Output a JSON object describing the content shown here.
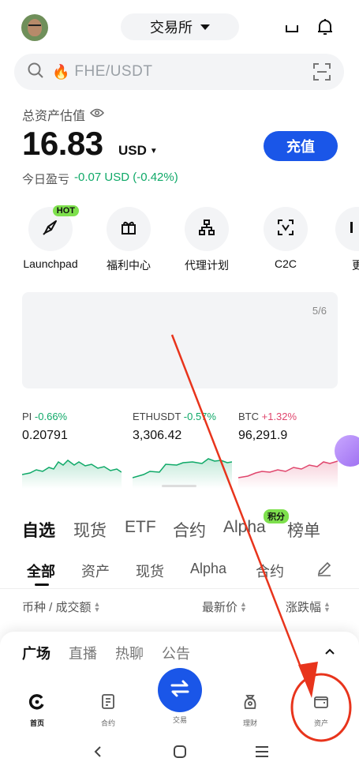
{
  "header": {
    "exchange_label": "交易所",
    "icons": [
      "avatar",
      "exchange-caret-icon",
      "inbox-icon",
      "bell-icon"
    ]
  },
  "search": {
    "placeholder": "FHE/USDT",
    "fire_icon": "🔥"
  },
  "assets": {
    "label": "总资产估值",
    "value": "16.83",
    "unit": "USD",
    "deposit_label": "充值",
    "pnl_label": "今日盈亏",
    "pnl_value": "-0.07 USD (-0.42%)"
  },
  "shortcuts": [
    {
      "label": "Launchpad",
      "icon": "rocket-icon",
      "badge": "HOT"
    },
    {
      "label": "福利中心",
      "icon": "gift-icon"
    },
    {
      "label": "代理计划",
      "icon": "org-chart-icon"
    },
    {
      "label": "C2C",
      "icon": "c2c-icon"
    },
    {
      "label": "更",
      "icon": "more-icon"
    }
  ],
  "banner": {
    "page": "5/6"
  },
  "tickers": [
    {
      "symbol": "PI",
      "change": "-0.66%",
      "price": "0.20791",
      "dir": "down"
    },
    {
      "symbol": "ETHUSDT",
      "change": "-0.57%",
      "price": "3,306.42",
      "dir": "down"
    },
    {
      "symbol": "BTC",
      "change": "+1.32%",
      "price": "96,291.9",
      "dir": "up"
    }
  ],
  "market_tabs": [
    "自选",
    "现货",
    "ETF",
    "合约",
    "Alpha",
    "榜单"
  ],
  "market_tab_badge": "积分",
  "sub_tabs": [
    "全部",
    "资产",
    "现货",
    "Alpha",
    "合约"
  ],
  "columns": {
    "pair": "币种 / 成交额",
    "last": "最新价",
    "change": "涨跌幅"
  },
  "feed_tabs": [
    "广场",
    "直播",
    "热聊",
    "公告"
  ],
  "bottom_nav": [
    {
      "label": "首页",
      "icon": "home-icon"
    },
    {
      "label": "合约",
      "icon": "contract-icon"
    },
    {
      "label": "交易",
      "icon": "trade-swap-icon"
    },
    {
      "label": "理财",
      "icon": "earn-icon"
    },
    {
      "label": "资产",
      "icon": "wallet-icon"
    }
  ],
  "colors": {
    "accent": "#1a56e8",
    "positive": "#0fa968",
    "negative": "#e0466d",
    "annotation": "#e8341c"
  }
}
